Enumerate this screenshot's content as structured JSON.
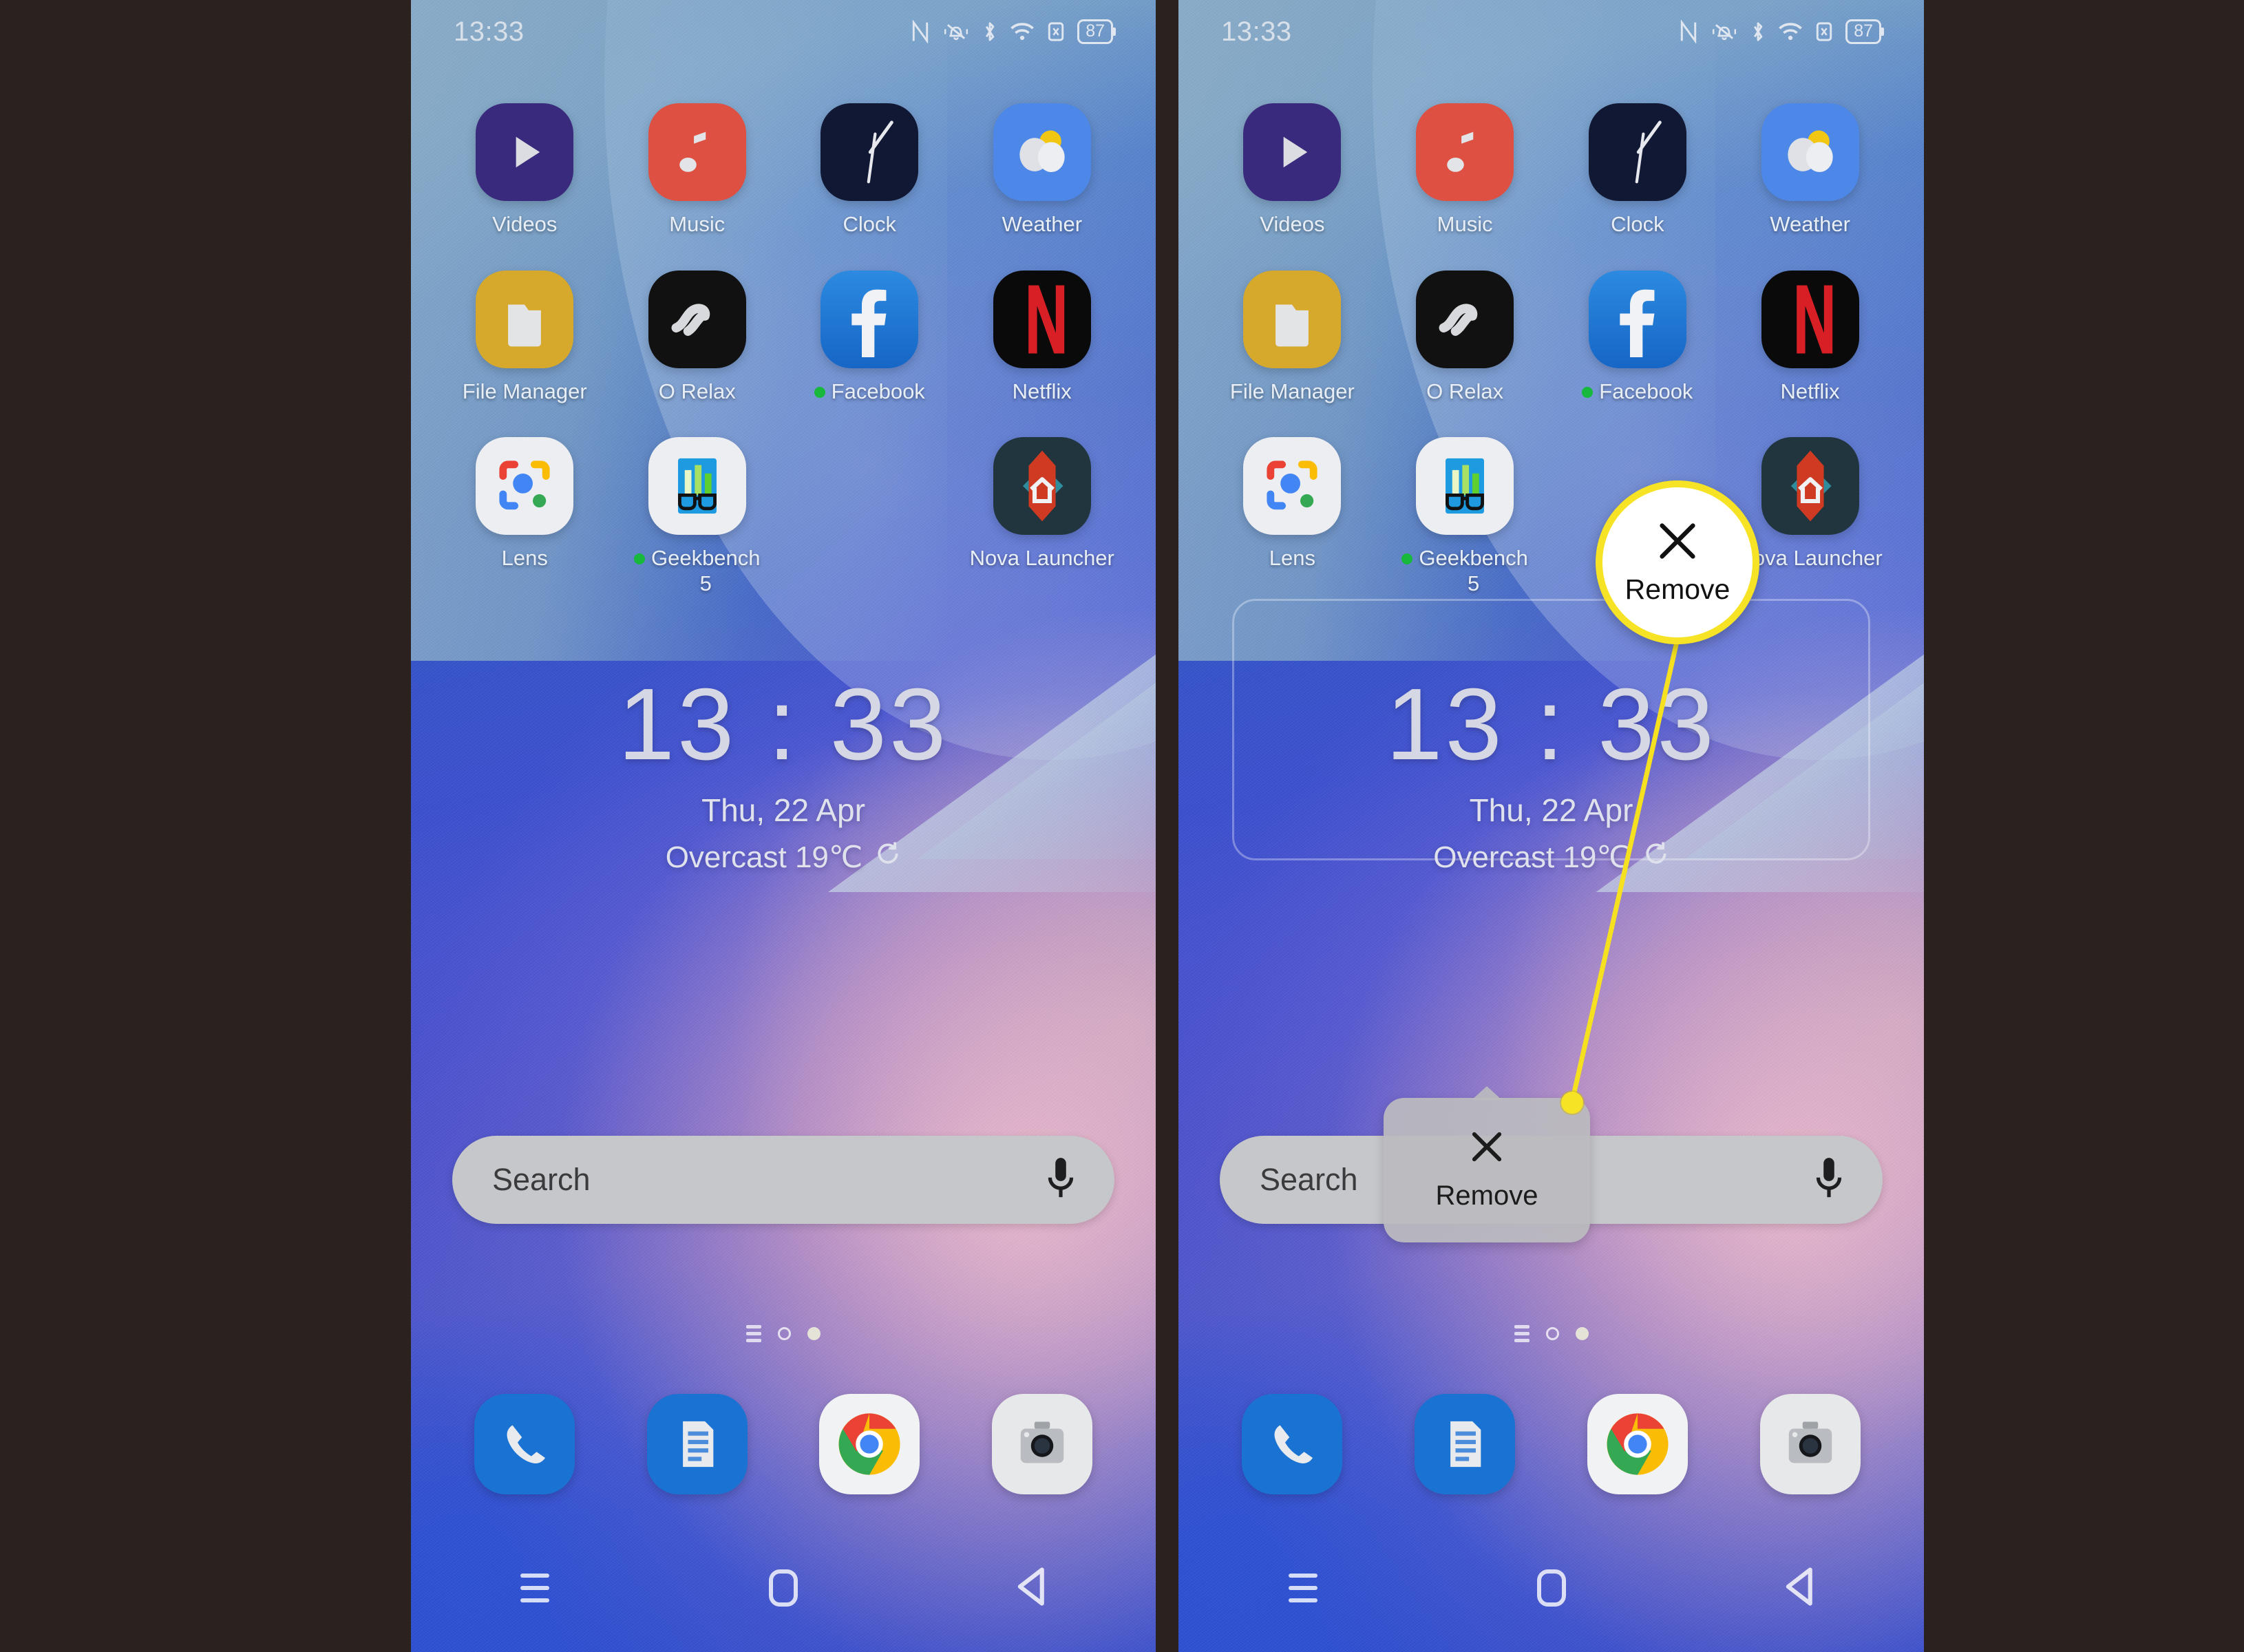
{
  "statusbar": {
    "time": "13:33",
    "battery_percent": "87",
    "icons": [
      "nfc-icon",
      "vibrate-mute-icon",
      "bluetooth-icon",
      "wifi-icon",
      "sim-no-card-icon",
      "battery-icon"
    ]
  },
  "home": {
    "apps": [
      {
        "label": "Videos",
        "icon": "videos-icon",
        "badge": false
      },
      {
        "label": "Music",
        "icon": "music-icon",
        "badge": false
      },
      {
        "label": "Clock",
        "icon": "clock-icon",
        "badge": false
      },
      {
        "label": "Weather",
        "icon": "weather-icon",
        "badge": false
      },
      {
        "label": "File Manager",
        "icon": "file-manager-icon",
        "badge": false
      },
      {
        "label": "O Relax",
        "icon": "o-relax-icon",
        "badge": false
      },
      {
        "label": "Facebook",
        "icon": "facebook-icon",
        "badge": true
      },
      {
        "label": "Netflix",
        "icon": "netflix-icon",
        "badge": false
      },
      {
        "label": "Lens",
        "icon": "google-lens-icon",
        "badge": false
      },
      {
        "label": "Geekbench\n5",
        "icon": "geekbench-icon",
        "badge": true
      },
      {
        "label": "",
        "icon": "empty-slot",
        "badge": false
      },
      {
        "label": "Nova Launcher",
        "icon": "nova-launcher-icon",
        "badge": false
      }
    ],
    "dock": [
      {
        "label": "Phone",
        "icon": "phone-icon"
      },
      {
        "label": "Messages",
        "icon": "messages-icon"
      },
      {
        "label": "Chrome",
        "icon": "chrome-icon"
      },
      {
        "label": "Camera",
        "icon": "camera-icon"
      }
    ]
  },
  "widget": {
    "time": "13 : 33",
    "date": "Thu, 22 Apr",
    "weather": "Overcast 19℃",
    "refresh_icon": "refresh-icon"
  },
  "search": {
    "placeholder": "Search",
    "mic_icon": "microphone-icon"
  },
  "page_indicator": {
    "app_drawer_icon": "app-drawer-icon",
    "dots": [
      "hollow",
      "filled"
    ]
  },
  "navbar": {
    "recents_icon": "recents-icon",
    "home_icon": "home-icon",
    "back_icon": "back-icon"
  },
  "remove_target": {
    "label": "Remove",
    "close_icon": "close-x-icon"
  },
  "annotation": {
    "callout_label": "Remove",
    "callout_icon": "close-x-icon",
    "highlight_color": "#f7e326",
    "anchor_dot": "annotation-anchor-dot"
  },
  "colors": {
    "page_background": "#2b211f",
    "highlight": "#f7e326",
    "badge_green": "#17b83c",
    "search_bar": "#c6c7cb",
    "remove_panel": "#babab e"
  }
}
